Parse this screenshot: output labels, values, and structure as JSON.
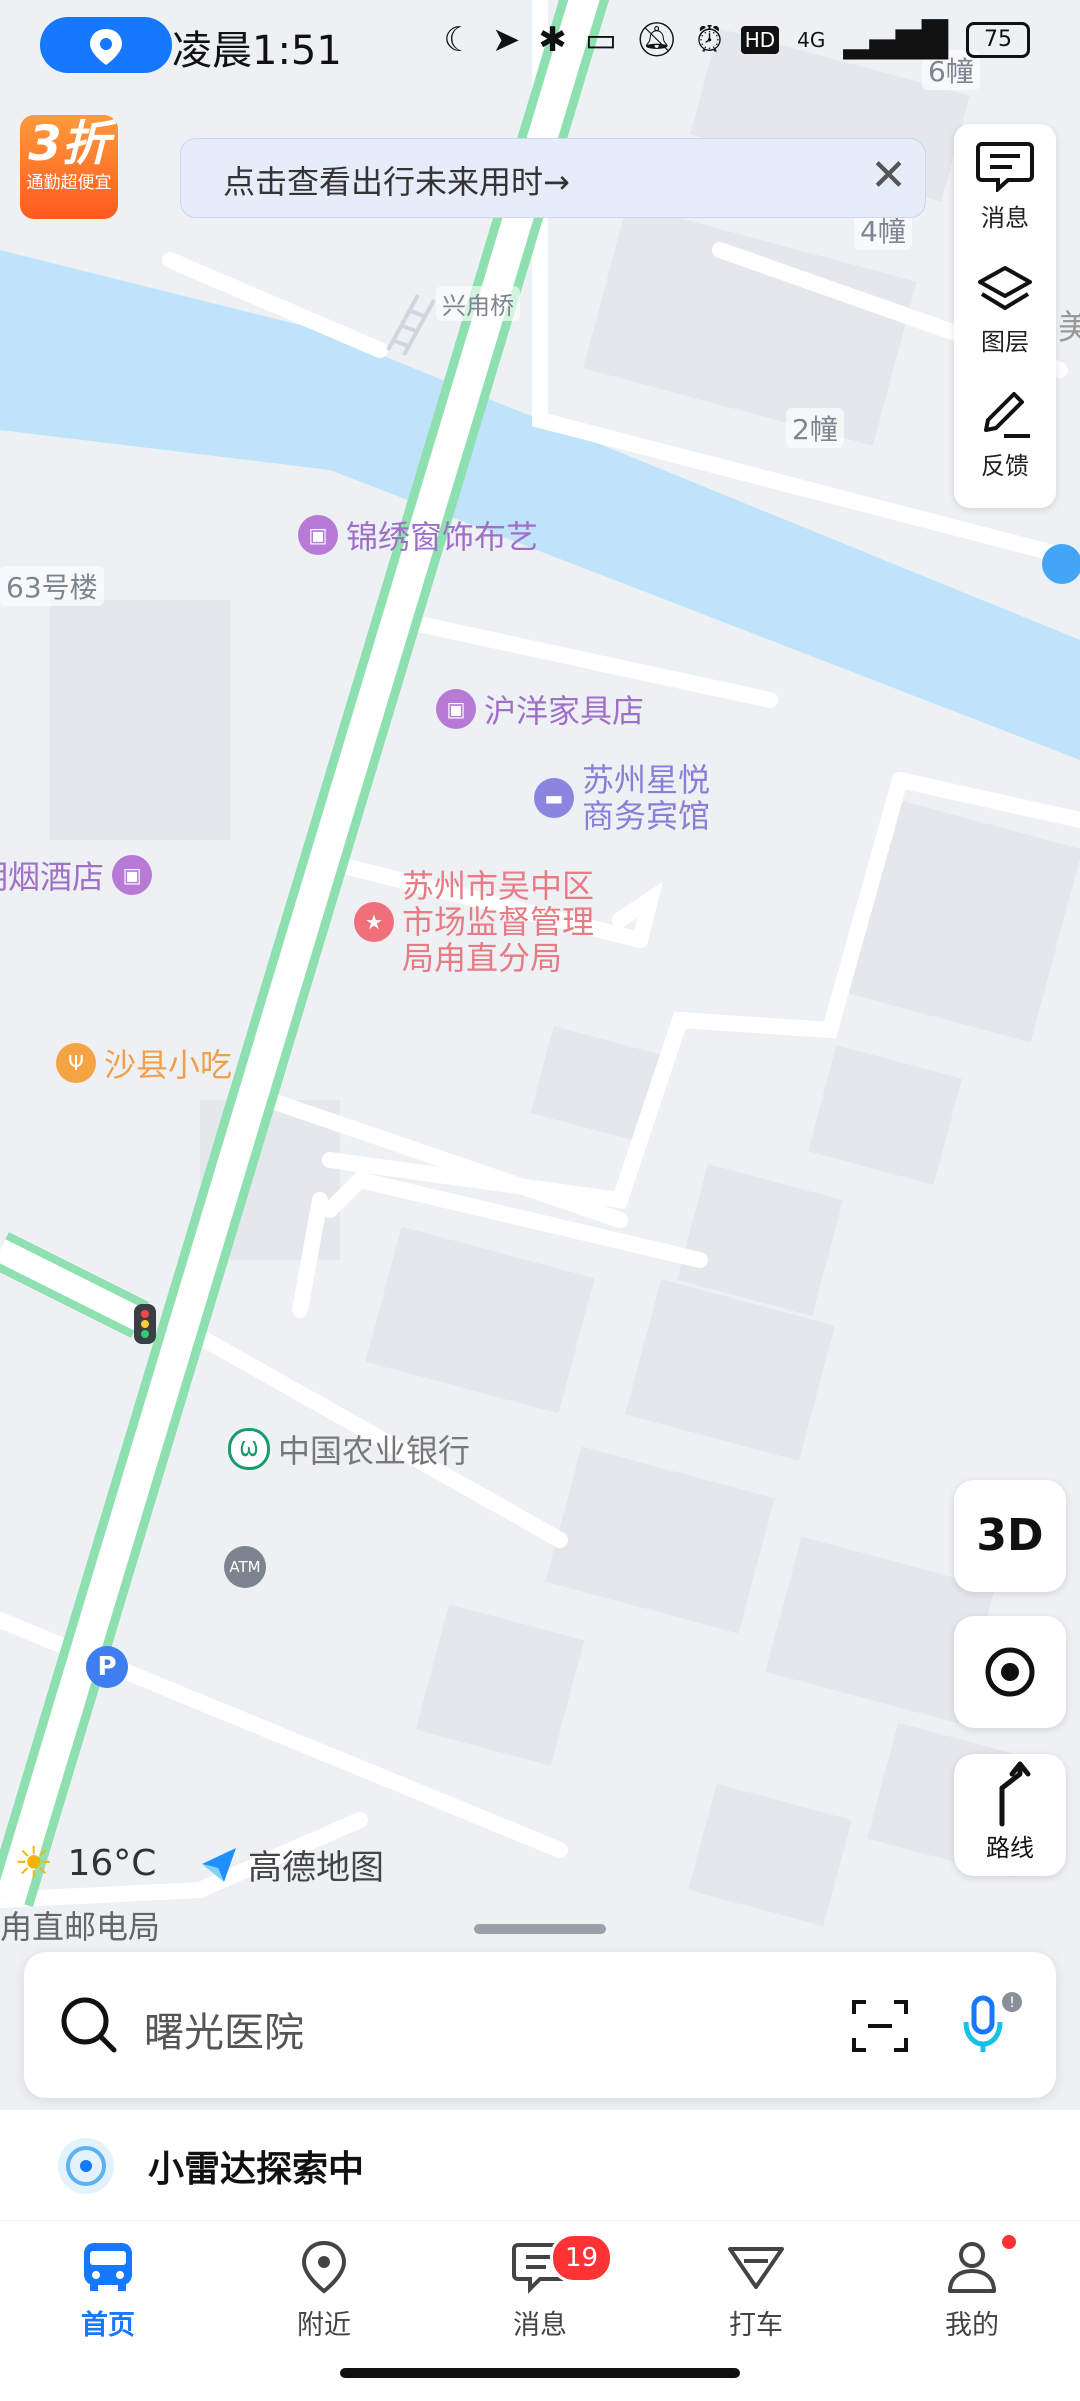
{
  "status_bar": {
    "time": "凌晨1:51",
    "network": "4G",
    "hd": "HD",
    "battery": "75"
  },
  "promo": {
    "big": "3折",
    "small": "通勤超便宜"
  },
  "notice": {
    "text": "点击查看出行未来用时→"
  },
  "toolbar": {
    "messages_label": "消息",
    "layers_label": "图层",
    "feedback_label": "反馈"
  },
  "map_controls": {
    "three_d_label": "3D",
    "route_label": "路线"
  },
  "map_labels": {
    "bridge": "兴甪桥",
    "buildings": [
      "6幢",
      "4幢",
      "2幢",
      "63号楼"
    ],
    "poi_jinxiu": "锦绣窗饰布艺",
    "poi_huyang": "沪洋家具店",
    "poi_xingyue_1": "苏州星悦",
    "poi_xingyue_2": "商务宾馆",
    "poi_yanjiu": "明烟酒店",
    "poi_gov_1": "苏州市吴中区",
    "poi_gov_2": "市场监督管理",
    "poi_gov_3": "局甪直分局",
    "poi_shaxian": "沙县小吃",
    "poi_bank": "中国农业银行",
    "poi_atm": "ATM",
    "poi_parking": "P",
    "poi_post": "甪直邮电局",
    "side_partial": "美"
  },
  "weather": {
    "temp": "16°C"
  },
  "brand": {
    "name": "高德地图"
  },
  "search": {
    "placeholder": "曙光医院"
  },
  "radar": {
    "label": "小雷达探索中"
  },
  "nav": {
    "items": [
      {
        "label": "首页"
      },
      {
        "label": "附近"
      },
      {
        "label": "消息",
        "badge": "19"
      },
      {
        "label": "打车"
      },
      {
        "label": "我的"
      }
    ]
  },
  "colors": {
    "accent": "#1677ff",
    "water": "#bfe3fb",
    "road_green": "#8fe0b0",
    "badge": "#ff3333"
  }
}
